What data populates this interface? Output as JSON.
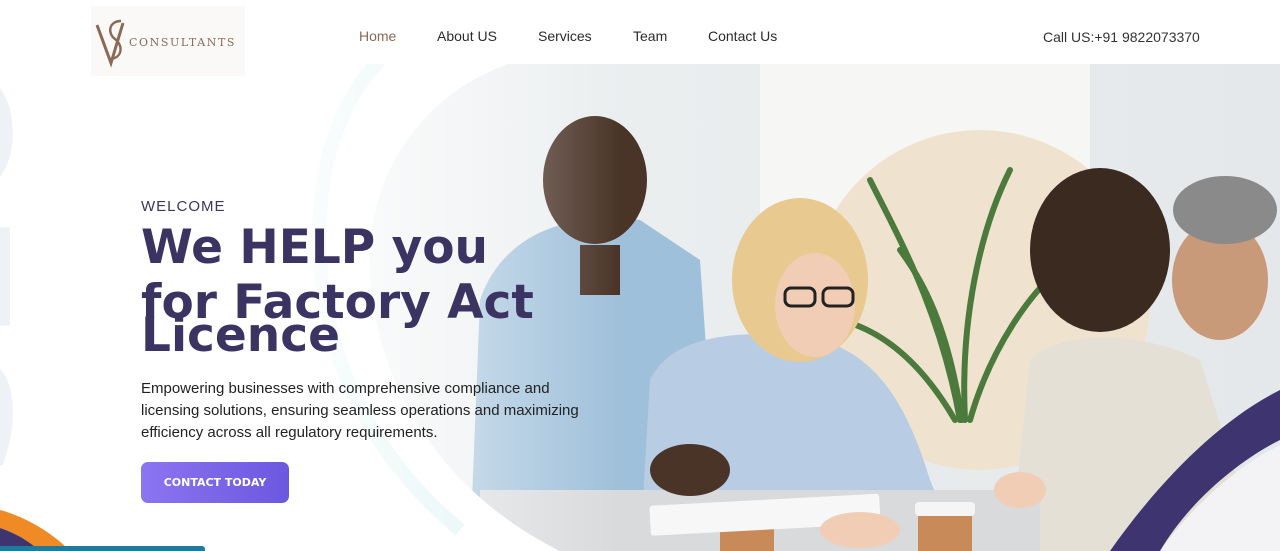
{
  "brand": {
    "logo_monogram": "VS",
    "logo_text": "CONSULTANTS"
  },
  "nav": {
    "items": [
      {
        "label": "Home",
        "active": true
      },
      {
        "label": "About US",
        "active": false
      },
      {
        "label": "Services",
        "active": false
      },
      {
        "label": "Team",
        "active": false
      },
      {
        "label": "Contact Us",
        "active": false
      }
    ]
  },
  "header": {
    "phone": "Call US:+91 9822073370"
  },
  "hero": {
    "eyebrow": "WELCOME",
    "headline_line1": "We HELP you",
    "headline_line2": "for Factory Act",
    "headline_line3": "Licence",
    "description": "Empowering businesses with comprehensive compliance and licensing solutions, ensuring seamless operations and maximizing efficiency across all regulatory requirements.",
    "cta_label": "CONTACT TODAY",
    "watermark": "SEO"
  },
  "colors": {
    "accent": "#7a64ea",
    "headline": "#3b3462",
    "brand": "#8a6a55",
    "swoosh": "#3e3570",
    "orange": "#f08a24"
  }
}
